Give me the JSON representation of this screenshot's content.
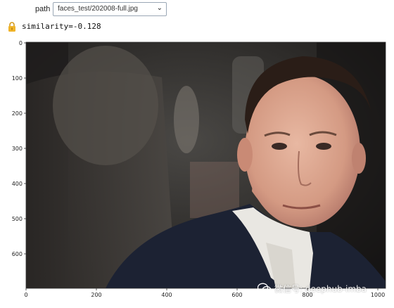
{
  "widget": {
    "path_label": "path",
    "path_value": "faces_test/202008-full.jpg"
  },
  "output": {
    "similarity_text": "similarity=-0.128"
  },
  "figure": {
    "y_ticks": [
      "0",
      "100",
      "200",
      "300",
      "400",
      "500",
      "600"
    ],
    "x_ticks": [
      "0",
      "200",
      "400",
      "600",
      "800",
      "1000"
    ],
    "image_description": "photo of a man in a dark suit and white shirt against a dark blurred background"
  },
  "watermark": {
    "text": "微信号: deephub-imba"
  },
  "colors": {
    "accent": "#f0b429",
    "select_border": "#9aa7b5",
    "suit": "#1c2233",
    "shirt": "#e9e7e2"
  },
  "icons": {
    "lock": "lock-icon",
    "dropdown": "chevron-down-icon",
    "wechat": "wechat-icon"
  }
}
